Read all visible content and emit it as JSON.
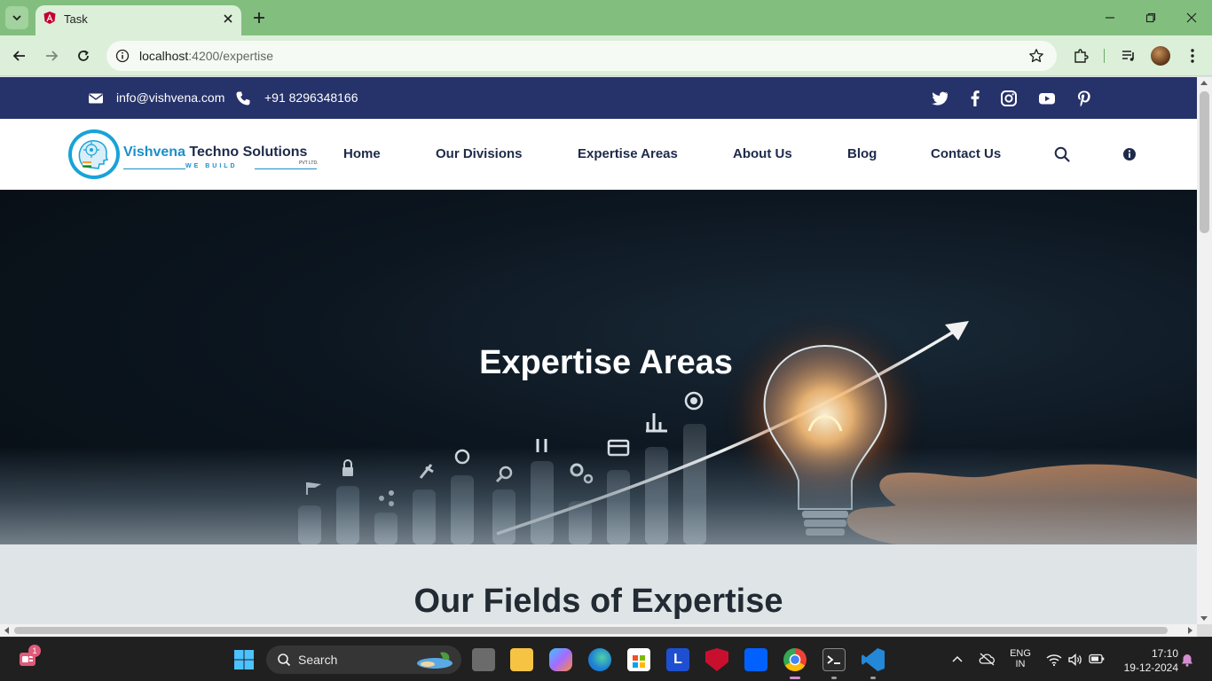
{
  "browser": {
    "tab_title": "Task",
    "url_host": "localhost",
    "url_rest": ":4200/expertise"
  },
  "topbar": {
    "email": "info@vishvena.com",
    "phone": "+91 8296348166",
    "social_icons": [
      "twitter-icon",
      "facebook-icon",
      "instagram-icon",
      "youtube-icon",
      "pinterest-icon"
    ]
  },
  "logo": {
    "name_part1": "Vishvena",
    "name_part2": " Techno Solutions",
    "pvt": "PVT LTD.",
    "tagline": "WE BUILD"
  },
  "nav": {
    "items": [
      "Home",
      "Our Divisions",
      "Expertise Areas",
      "About Us",
      "Blog",
      "Contact Us"
    ]
  },
  "hero": {
    "title": "Expertise Areas"
  },
  "section": {
    "title": "Our Fields of Expertise"
  },
  "taskbar": {
    "search_label": "Search",
    "lang_line1": "ENG",
    "lang_line2": "IN",
    "time": "17:10",
    "date": "19-12-2024",
    "notification_count": "1"
  },
  "colors": {
    "topbar_bg": "#26326a",
    "brand_blue": "#1a8fcb",
    "chrome_green": "#82bf7e"
  }
}
